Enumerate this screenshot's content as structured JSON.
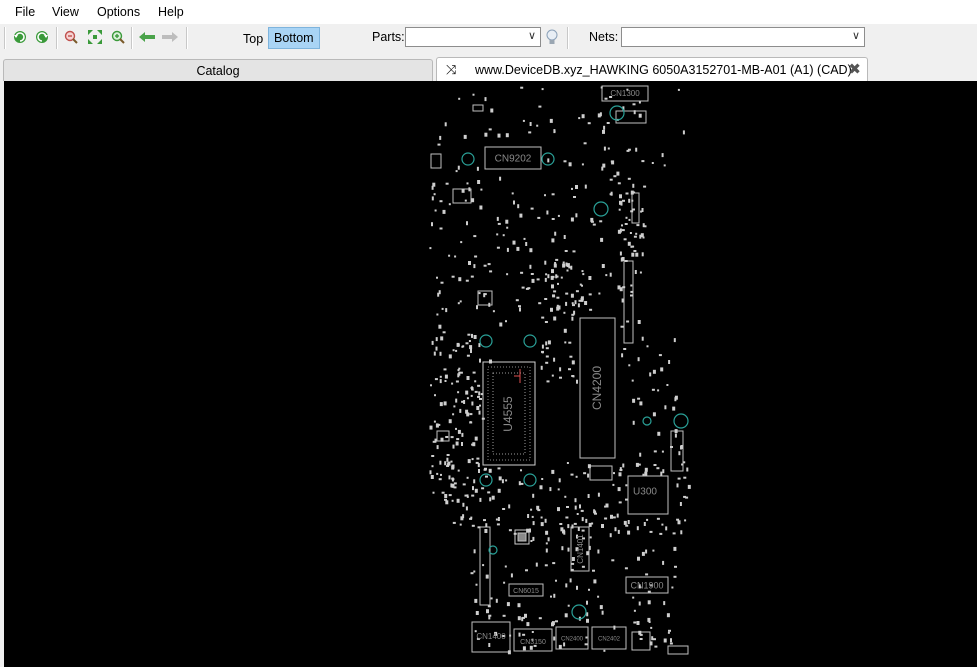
{
  "menu": {
    "file": "File",
    "view": "View",
    "options": "Options",
    "help": "Help"
  },
  "toolbar": {
    "icons": [
      "rotate-left-icon",
      "rotate-right-icon",
      "zoom-out-icon",
      "fit-icon",
      "zoom-in-icon",
      "back-arrow-icon",
      "forward-arrow-icon"
    ],
    "side_top": "Top",
    "side_bottom": "Bottom",
    "side_selected": "Bottom",
    "parts_label": "Parts:",
    "parts_value": "",
    "nets_label": "Nets:",
    "nets_value": ""
  },
  "tabs": {
    "catalog": "Catalog",
    "board": "www.DeviceDB.xyz_HAWKING 6050A3152701-MB-A01 (A1) (CAD)"
  },
  "board": {
    "background": "#000000",
    "outline_color": "#bfbfbf",
    "hole_color": "#2aa198",
    "labels": [
      "CN1300",
      "CN9202",
      "CN4200",
      "U4555",
      "U300",
      "CN1401",
      "CN1900",
      "CN6015",
      "CN1400",
      "CN3150",
      "CN2400",
      "CN2402"
    ]
  }
}
